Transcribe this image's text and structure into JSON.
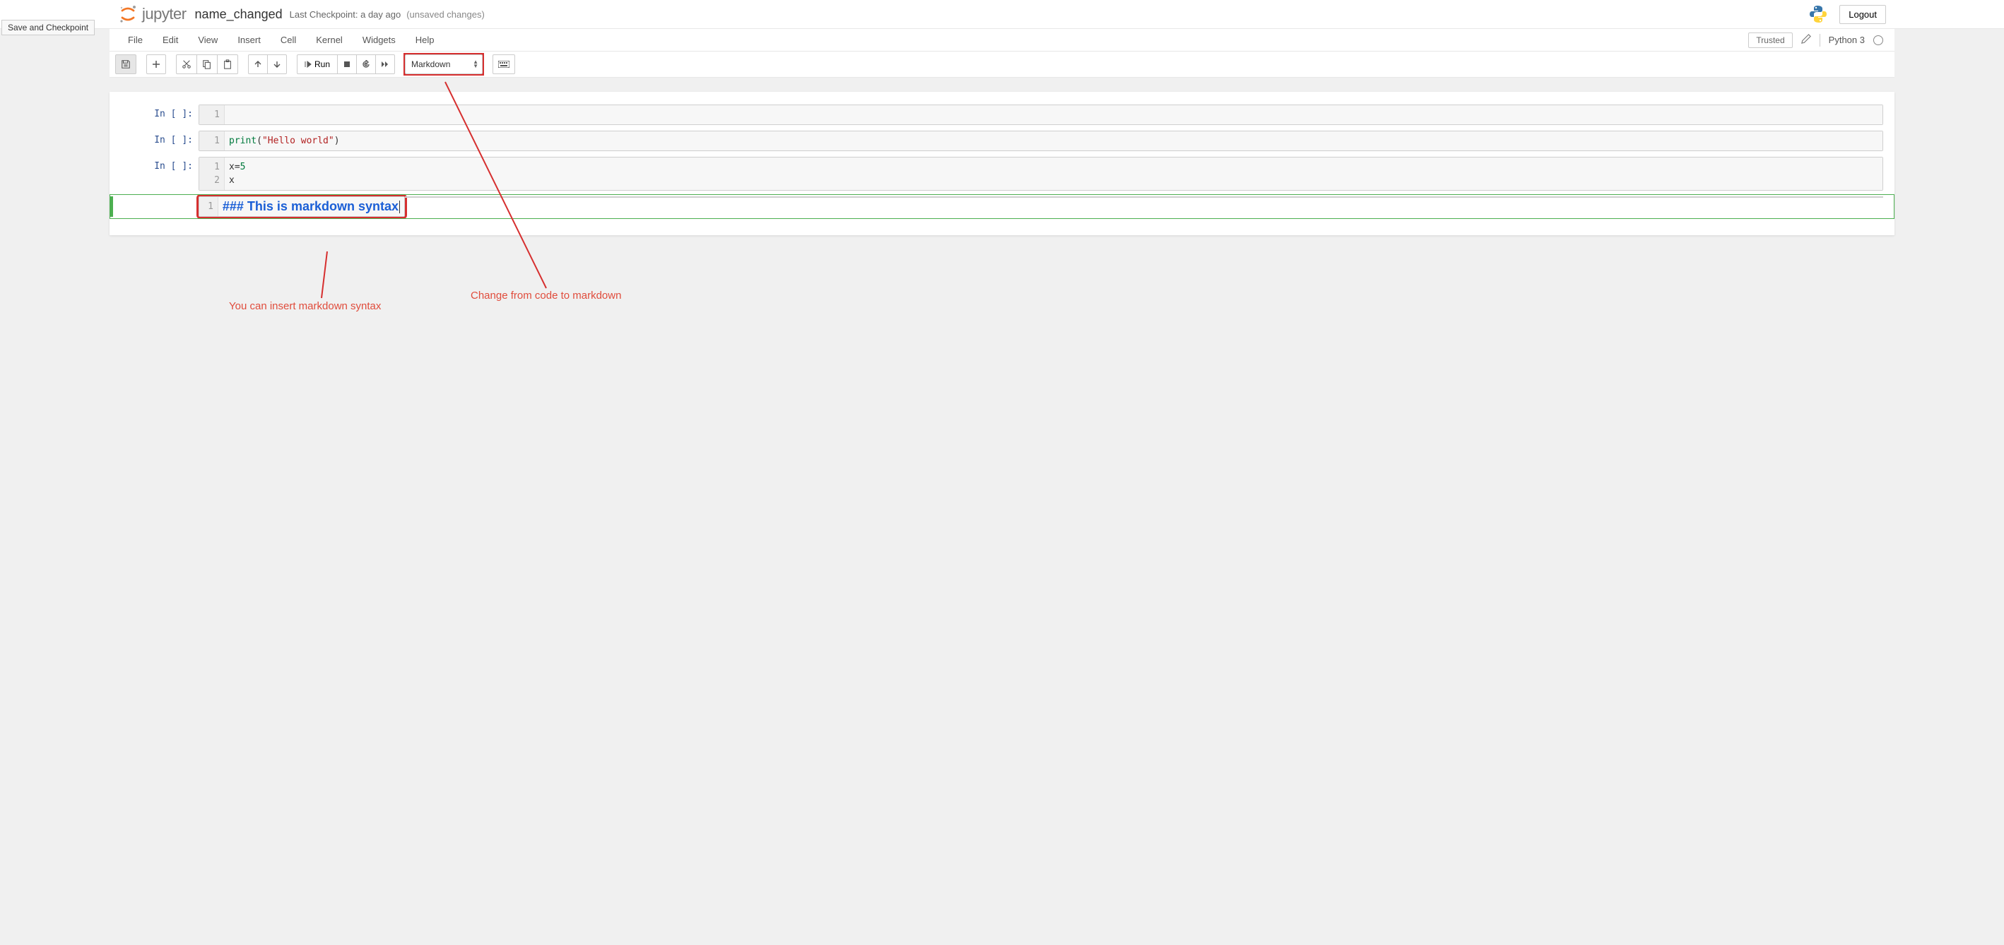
{
  "tooltip": "Save and Checkpoint",
  "header": {
    "logo_text": "jupyter",
    "notebook_name": "name_changed",
    "checkpoint": "Last Checkpoint: a day ago",
    "autosave": "(unsaved changes)",
    "logout": "Logout"
  },
  "menubar": {
    "items": [
      "File",
      "Edit",
      "View",
      "Insert",
      "Cell",
      "Kernel",
      "Widgets",
      "Help"
    ],
    "trusted": "Trusted",
    "kernel": "Python 3"
  },
  "toolbar": {
    "run": "Run",
    "cell_type": "Markdown"
  },
  "cells": [
    {
      "prompt": "In [ ]:",
      "lines": [
        "1"
      ],
      "code": [
        ""
      ]
    },
    {
      "prompt": "In [ ]:",
      "lines": [
        "1"
      ],
      "tokens": [
        [
          {
            "t": "print",
            "c": "tk-kw"
          },
          {
            "t": "(",
            "c": "tk-paren"
          },
          {
            "t": "\"Hello world\"",
            "c": "tk-str"
          },
          {
            "t": ")",
            "c": "tk-paren"
          }
        ]
      ]
    },
    {
      "prompt": "In [ ]:",
      "lines": [
        "1",
        "2"
      ],
      "tokens": [
        [
          {
            "t": "x",
            "c": "tk-var"
          },
          {
            "t": "=",
            "c": "tk-var"
          },
          {
            "t": "5",
            "c": "tk-num"
          }
        ],
        [
          {
            "t": "x",
            "c": "tk-var"
          }
        ]
      ]
    },
    {
      "prompt": "",
      "md": true,
      "lines": [
        "1"
      ],
      "code": [
        "### This is markdown syntax"
      ]
    }
  ],
  "annotations": {
    "ann1": "Change from code to markdown",
    "ann2": "You can insert markdown syntax"
  }
}
